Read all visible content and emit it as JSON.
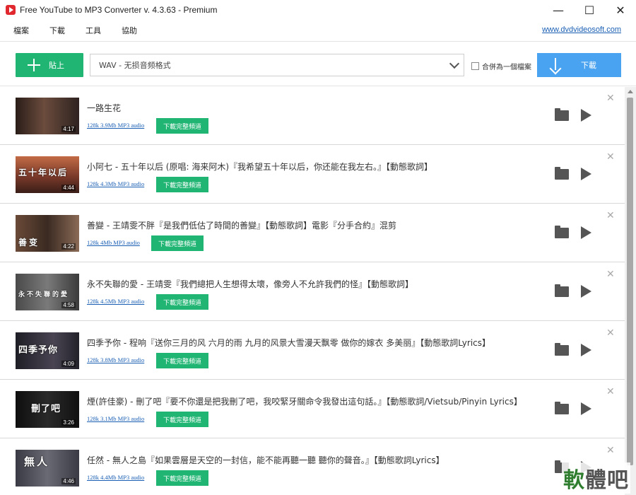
{
  "window": {
    "title": "Free YouTube to MP3 Converter v. 4.3.63 - Premium",
    "minimize": "—",
    "maximize": "☐",
    "close": "✕"
  },
  "menu": {
    "file": "檔案",
    "download": "下載",
    "tools": "工具",
    "help": "協助",
    "site": "www.dvdvideosoft.com"
  },
  "toolbar": {
    "paste_label": "貼上",
    "format_value": "WAV - 无损音频格式",
    "merge_label": "合併為一個檔案",
    "download_label": "下載"
  },
  "items": [
    {
      "title": "一路生花",
      "meta": "128k 3.9Mb MP3 audio",
      "duration": "4:17",
      "button": "下載完整頻道",
      "thumb_text": "",
      "thumb_color": "#3b2a24"
    },
    {
      "title": "小阿七 - 五十年以后 (原唱: 海来阿木)『我希望五十年以后，你还能在我左右。』【動態歌詞】",
      "meta": "128k 4.3Mb MP3 audio",
      "duration": "4:44",
      "button": "下載完整頻道",
      "thumb_text": "五十年以后",
      "thumb_color": "#7a3a2a"
    },
    {
      "title": "善變 - 王靖雯不胖『是我們低估了時間的善變』【動態歌詞】電影『分手合約』混剪",
      "meta": "128k 4Mb MP3 audio",
      "duration": "4:22",
      "button": "下載完整頻道",
      "thumb_text": "善变",
      "thumb_color": "#4a3326"
    },
    {
      "title": "永不失聯的愛 - 王靖雯『我們總把人生想得太壞，像旁人不允許我們的怪』【動態歌詞】",
      "meta": "128k 4.5Mb MP3 audio",
      "duration": "4:58",
      "button": "下載完整頻道",
      "thumb_text": "永不失聯的愛",
      "thumb_color": "#5d5d5d"
    },
    {
      "title": "四季予你 - 程响『送你三月的风 六月的雨 九月的风景大雪漫天飘零 做你的嫁衣 多美丽』【動態歌詞Lyrics】",
      "meta": "128k 3.8Mb MP3 audio",
      "duration": "4:09",
      "button": "下載完整頻道",
      "thumb_text": "四季予你",
      "thumb_color": "#2b2b33"
    },
    {
      "title": "煙(許佳豪) - 刪了吧『要不你還是把我刪了吧，我咬緊牙關命令我發出這句話。』【動態歌詞/Vietsub/Pinyin Lyrics】",
      "meta": "128k 3.1Mb MP3 audio",
      "duration": "3:26",
      "button": "下載完整頻道",
      "thumb_text": "刪了吧",
      "thumb_color": "#1a1a1a"
    },
    {
      "title": "任然 - 無人之島『如果雲層是天空的一封信，能不能再聽一聽 聽你的聲音。』【動態歌詞Lyrics】",
      "meta": "128k 4.4Mb MP3 audio",
      "duration": "4:46",
      "button": "下載完整頻道",
      "thumb_text": "無人",
      "thumb_color": "#4a4a55"
    }
  ],
  "row_close": "✕",
  "watermark": {
    "a": "軟",
    "b": "體",
    "c": "吧"
  }
}
